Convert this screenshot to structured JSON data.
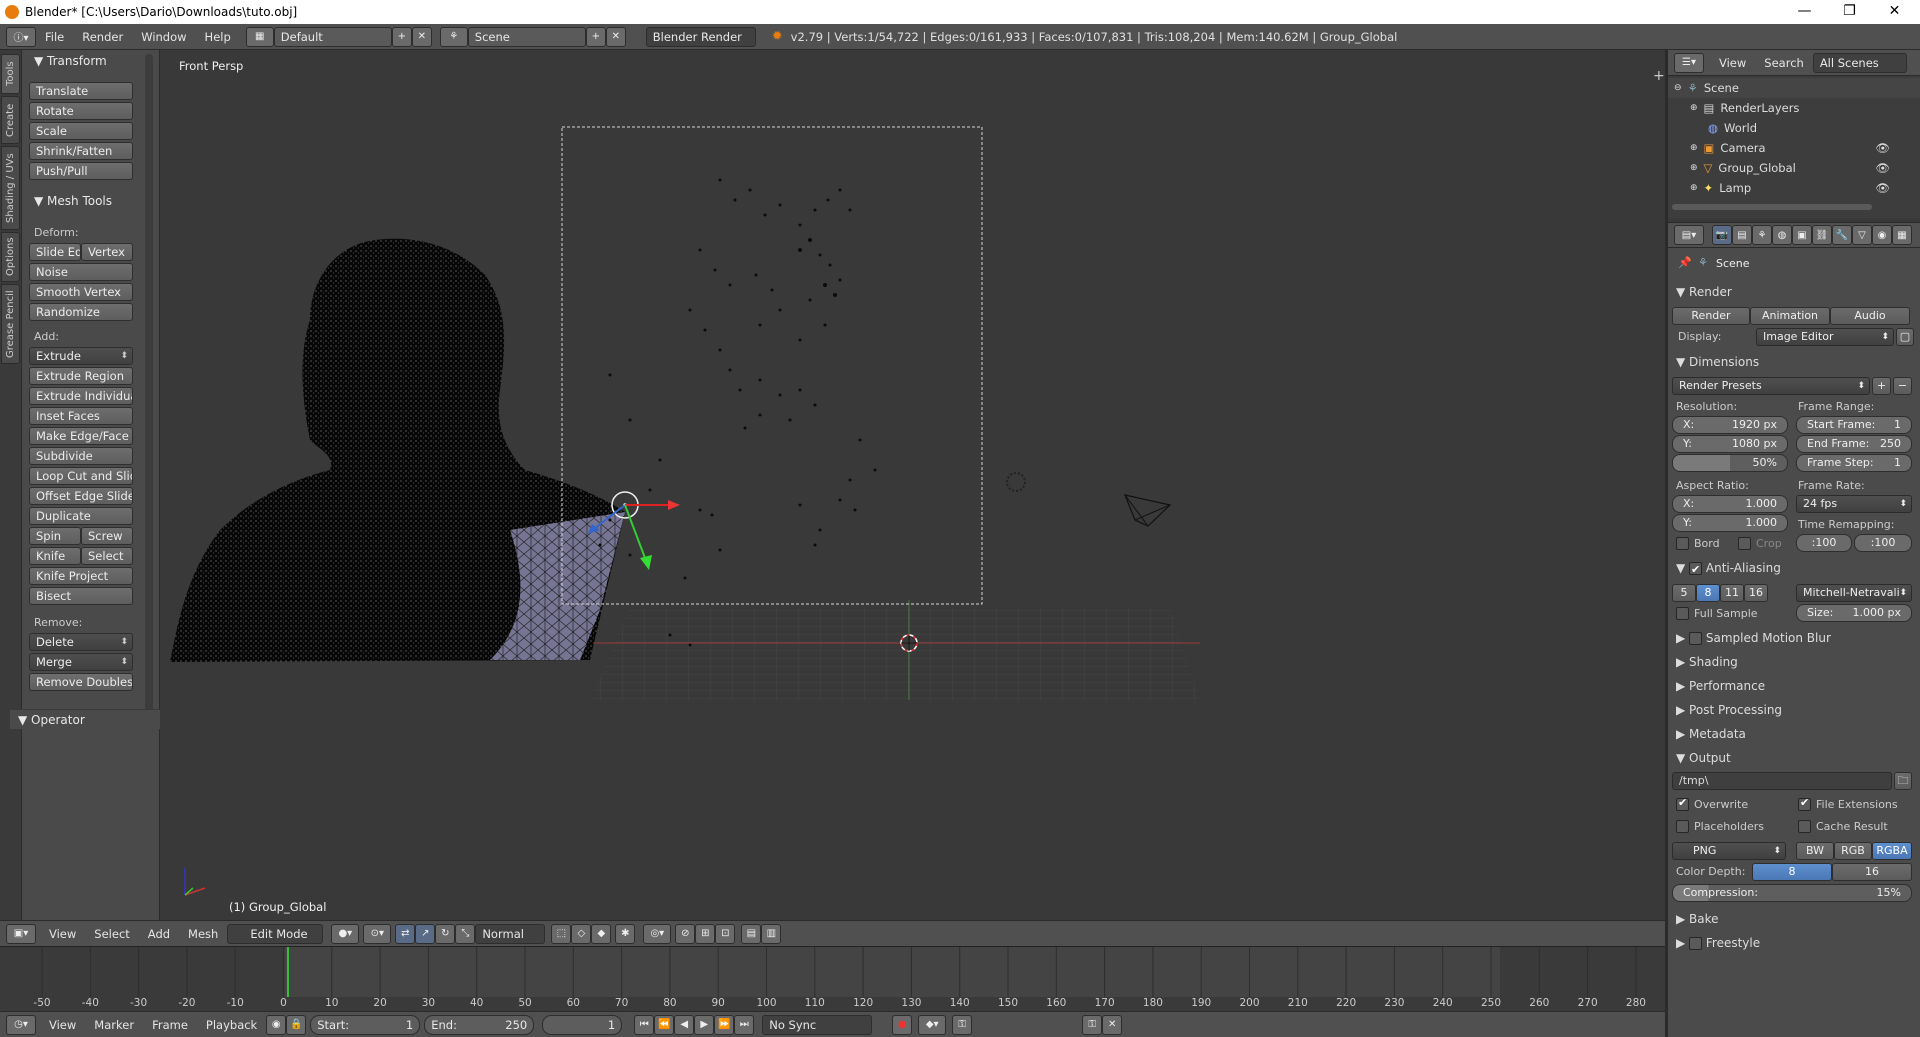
{
  "window": {
    "title": "Blender* [C:\\Users\\Dario\\Downloads\\tuto.obj]",
    "minimize": "—",
    "maximize": "❐",
    "close": "✕"
  },
  "infobar": {
    "menus": [
      "File",
      "Render",
      "Window",
      "Help"
    ],
    "layout": "Default",
    "scene": "Scene",
    "engine": "Blender Render",
    "stats": "v2.79 | Verts:1/54,722 | Edges:0/161,933 | Faces:0/107,831 | Tris:108,204 | Mem:140.62M | Group_Global"
  },
  "tool_tabs": [
    "Tools",
    "Create",
    "Shading / UVs",
    "Options",
    "Grease Pencil"
  ],
  "tools": {
    "transform_header": "Transform",
    "transform": [
      "Translate",
      "Rotate",
      "Scale",
      "Shrink/Fatten",
      "Push/Pull"
    ],
    "mesh_tools_header": "Mesh Tools",
    "deform_label": "Deform:",
    "slide_edge": "Slide Ed",
    "vertex": "Vertex",
    "noise": "Noise",
    "smooth_vertex": "Smooth Vertex",
    "randomize": "Randomize",
    "add_label": "Add:",
    "extrude": "Extrude",
    "extrude_region": "Extrude Region",
    "extrude_individual": "Extrude Individual",
    "inset_faces": "Inset Faces",
    "make_edge_face": "Make Edge/Face",
    "subdivide": "Subdivide",
    "loop_cut": "Loop Cut and Slide",
    "offset_edge": "Offset Edge Slide",
    "duplicate": "Duplicate",
    "spin": "Spin",
    "screw": "Screw",
    "knife": "Knife",
    "select": "Select",
    "knife_project": "Knife Project",
    "bisect": "Bisect",
    "remove_label": "Remove:",
    "delete": "Delete",
    "merge": "Merge",
    "remove_doubles": "Remove Doubles",
    "operator_header": "Operator"
  },
  "viewport": {
    "view_label": "Front Persp",
    "object_label": "(1) Group_Global"
  },
  "viewport_header": {
    "menus": [
      "View",
      "Select",
      "Add",
      "Mesh"
    ],
    "mode": "Edit Mode",
    "pivot": "Normal"
  },
  "timeline": {
    "ticks": [
      "-50",
      "-40",
      "-30",
      "-20",
      "-10",
      "0",
      "10",
      "20",
      "30",
      "40",
      "50",
      "60",
      "70",
      "80",
      "90",
      "100",
      "110",
      "120",
      "130",
      "140",
      "150",
      "160",
      "170",
      "180",
      "190",
      "200",
      "210",
      "220",
      "230",
      "240",
      "250",
      "260",
      "270",
      "280"
    ],
    "menus": [
      "View",
      "Marker",
      "Frame",
      "Playback"
    ],
    "start_label": "Start:",
    "start": "1",
    "end_label": "End:",
    "end": "250",
    "current": "1",
    "sync": "No Sync"
  },
  "outliner": {
    "menus": [
      "View",
      "Search"
    ],
    "filter": "All Scenes",
    "items": [
      "Scene",
      "RenderLayers",
      "World",
      "Camera",
      "Group_Global",
      "Lamp"
    ]
  },
  "properties": {
    "scene": "Scene",
    "render_header": "Render",
    "render_btn": "Render",
    "animation_btn": "Animation",
    "audio_btn": "Audio",
    "display_label": "Display:",
    "display_value": "Image Editor",
    "dimensions_header": "Dimensions",
    "render_presets": "Render Presets",
    "resolution_label": "Resolution:",
    "res_x": "X:",
    "res_x_val": "1920 px",
    "res_y": "Y:",
    "res_y_val": "1080 px",
    "res_pct": "50%",
    "frame_range_label": "Frame Range:",
    "start_frame": "Start Frame:",
    "start_frame_val": "1",
    "end_frame": "End Frame:",
    "end_frame_val": "250",
    "frame_step": "Frame Step:",
    "frame_step_val": "1",
    "aspect_label": "Aspect Ratio:",
    "asp_x": "X:",
    "asp_x_val": "1.000",
    "asp_y": "Y:",
    "asp_y_val": "1.000",
    "frame_rate_label": "Frame Rate:",
    "frame_rate": "24 fps",
    "time_remap_label": "Time Remapping:",
    "remap_old": ":100",
    "remap_new": ":100",
    "bord": "Bord",
    "crop": "Crop",
    "aa_header": "Anti-Aliasing",
    "aa_samples": [
      "5",
      "8",
      "11",
      "16"
    ],
    "aa_filter": "Mitchell-Netravali",
    "full_sample": "Full Sample",
    "aa_size": "Size:",
    "aa_size_val": "1.000 px",
    "motion_blur": "Sampled Motion Blur",
    "shading": "Shading",
    "performance": "Performance",
    "post_processing": "Post Processing",
    "metadata": "Metadata",
    "output_header": "Output",
    "output_path": "/tmp\\",
    "overwrite": "Overwrite",
    "file_extensions": "File Extensions",
    "placeholders": "Placeholders",
    "cache_result": "Cache Result",
    "format": "PNG",
    "color_modes": [
      "BW",
      "RGB",
      "RGBA"
    ],
    "color_depth_label": "Color Depth:",
    "depths": [
      "8",
      "16"
    ],
    "compression": "Compression:",
    "compression_val": "15%",
    "bake": "Bake",
    "freestyle": "Freestyle"
  }
}
